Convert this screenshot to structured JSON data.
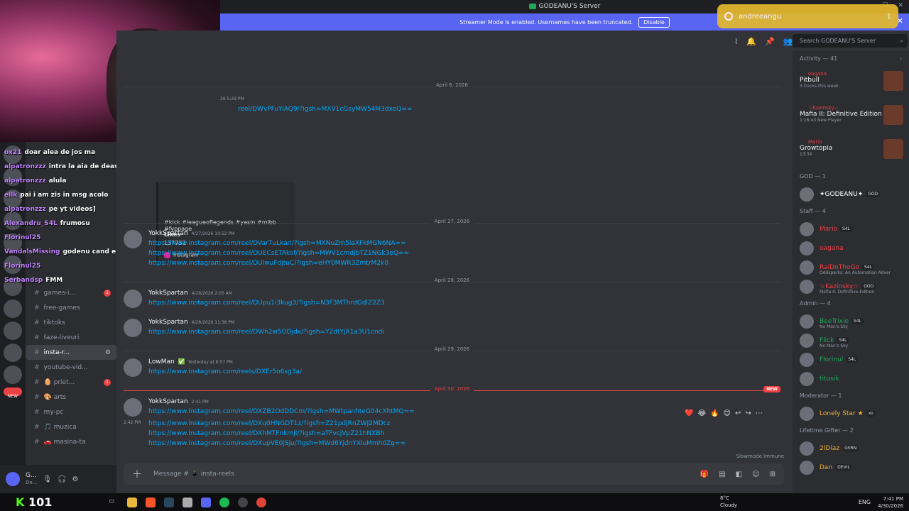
{
  "window": {
    "title": "GODEANU'S Server",
    "controls": [
      "—",
      "☐",
      "✕"
    ]
  },
  "streamer": {
    "text": "Streamer Mode is enabled. Usernames have been truncated.",
    "disable": "Disable"
  },
  "toast": {
    "name": "andreeangu",
    "count": "1"
  },
  "search": {
    "placeholder": "Search GODEANU'S Server"
  },
  "meme": {
    "label": "x10"
  },
  "embed": {
    "partial_ts": "26 5:29 PM",
    "link": "reel/DWvPFuYiAQ9/?igsh=MXV1cGsyMW54M3dxeQ==",
    "tags": "#kick #leagueoflegends #yasin #mlbb #fyppage",
    "likes_label": "Likes",
    "likes": "137732",
    "provider": "Instagram"
  },
  "dates": {
    "d1": "April 6, 2026",
    "d2": "April 27, 2026",
    "d3": "April 28, 2026",
    "d4": "April 29, 2026",
    "d5": "April 30, 2026",
    "new": "NEW"
  },
  "messages": [
    {
      "author": "YokkSpartan",
      "ts": "4/27/2026 10:52 PM",
      "links": [
        "https://www.instagram.com/reel/DVar7uLkari/?igsh=MXNuZm5laXFkMGN6NA==",
        "https://www.instagram.com/reel/DUECsETAksf/?igsh=MWV1cmdjbTZ1NGk3eQ==",
        "https://www.instagram.com/reel/DUlwuFdjtuC/?igsh=eHY0MWR3ZmtrM2k0"
      ]
    },
    {
      "author": "YokkSpartan",
      "ts": "4/28/2026 2:05 AM",
      "links": [
        "https://www.instagram.com/reel/DUpu1i3kug3/?igsh=N3F3MThrdGdlZ2Z3"
      ]
    },
    {
      "author": "YokkSpartan",
      "ts": "4/28/2026 11:38 PM",
      "links": [
        "https://www.instagram.com/reel/DWh2w5ODjdx/?igsh=Y2dtYjA1a3U1cndi"
      ]
    },
    {
      "author": "LowMan",
      "badge": "✅",
      "ts": "Yesterday at 8:57 PM",
      "links": [
        "https://www.instagram.com/reels/DXEr5o6sg3a/"
      ]
    },
    {
      "author": "YokkSpartan",
      "ts": "2:41 PM",
      "links": [
        "https://www.instagram.com/reel/DXZB2OdDDCm/?igsh=MWtpanhteG04cXhtMQ==",
        "https://www.instagram.com/reel/DXq0HNGDT1z/?igsh=Z21pdjRnZWJ2MDcz",
        "https://www.instagram.com/reel/DXhMTFnkmJl/?igsh=aTFvcjVpZ21hNXBh",
        "https://www.instagram.com/reel/DXupVE0jSju/?igsh=MWd6YjdnYXluMmh0Zg=="
      ],
      "line_ts": "2:42 PM"
    }
  ],
  "reactions": [
    "❤️",
    "😂",
    "🔥",
    "😊",
    "↩",
    "↪",
    "⋯"
  ],
  "slowmode": "Slowmode Immune",
  "composer": {
    "placeholder": "Message # 📱 insta-reels"
  },
  "channels": [
    {
      "name": "games-i...",
      "badge": "1"
    },
    {
      "name": "free-games"
    },
    {
      "name": "tiktoks"
    },
    {
      "name": "faze-liveuri"
    },
    {
      "name": "insta-r...",
      "active": true
    },
    {
      "name": "youtube-vid..."
    },
    {
      "name": "🥚 priet...",
      "badge": "1"
    },
    {
      "name": "🎨 arts"
    },
    {
      "name": "my-pc"
    },
    {
      "name": "🎵 muzica"
    },
    {
      "name": "🚗 masina-ta"
    }
  ],
  "chat_overlay": [
    {
      "user": "ox21",
      "text": "doar alea de jos ma"
    },
    {
      "user": "alpatronzzz",
      "text": "intra la aia de deasupra'"
    },
    {
      "user": "alpatronzzz",
      "text": "alula"
    },
    {
      "user": "ellk",
      "text": "pai i am zis in msg acolo"
    },
    {
      "user": "alpatronzzz",
      "text": "pe yt videos]"
    },
    {
      "user": "Alexandru_S4L",
      "text": "frumosu"
    },
    {
      "user": "Florinul25",
      "text": ""
    },
    {
      "user": "VandalsMissing",
      "text": "godenu cand era mic"
    },
    {
      "user": "Florinul25",
      "text": ""
    },
    {
      "user": "Serbandsp",
      "text": "FMM"
    }
  ],
  "user": {
    "name": "G...",
    "status": "De..."
  },
  "kick": {
    "label": "K",
    "count": "101"
  },
  "activity": {
    "header": "Activity — 41",
    "items": [
      {
        "user": "oagana",
        "title": "Pitbull",
        "sub": "3 tracks this week"
      },
      {
        "user": "☆Kazinsky☆",
        "title": "Mafia II: Definitive Edition",
        "sub": "1:16:43 New Player"
      },
      {
        "user": "Mario",
        "title": "Growtopia",
        "sub": "13:34"
      }
    ]
  },
  "groups": [
    {
      "header": "GOD — 1",
      "members": [
        {
          "name": "✦GODEANU✦",
          "tag": "GOD",
          "color": "#ffffff"
        }
      ]
    },
    {
      "header": "Staff — 4",
      "members": [
        {
          "name": "Mario",
          "tag": "S4L",
          "color": "#f23f43"
        },
        {
          "name": "oagana",
          "color": "#f23f43"
        },
        {
          "name": "RaiDnTheGo",
          "tag": "S4L",
          "color": "#f23f43",
          "sub": "Oddsparks: An Automation Adver"
        },
        {
          "name": "☆Kazinsky☆",
          "tag": "GOD",
          "color": "#f23f43",
          "sub": "Mafia II: Definitive Edition"
        }
      ]
    },
    {
      "header": "Admin — 4",
      "members": [
        {
          "name": "BeeTrixie",
          "tag": "S4L",
          "color": "#23a55a",
          "sub": "No Man's Sky"
        },
        {
          "name": "Flick",
          "tag": "S4L",
          "color": "#23a55a",
          "sub": "No Man's Sky"
        },
        {
          "name": "Florinul",
          "tag": "S4L",
          "color": "#23a55a"
        },
        {
          "name": "titusik",
          "color": "#23a55a"
        }
      ]
    },
    {
      "header": "Moderator — 1",
      "members": [
        {
          "name": "Lonely Star ★",
          "tag": "xo",
          "color": "#f0b232"
        }
      ]
    },
    {
      "header": "Lifetime Gifter — 2",
      "members": [
        {
          "name": "2IDiaz",
          "tag": "GSRN",
          "color": "#f0b232"
        },
        {
          "name": "Dan",
          "tag": "DEVIL",
          "color": "#f0b232"
        }
      ]
    }
  ],
  "taskbar": {
    "weather_temp": "8°C",
    "weather": "Cloudy",
    "lang": "ENG",
    "time": "7:41 PM",
    "date": "4/30/2026"
  }
}
